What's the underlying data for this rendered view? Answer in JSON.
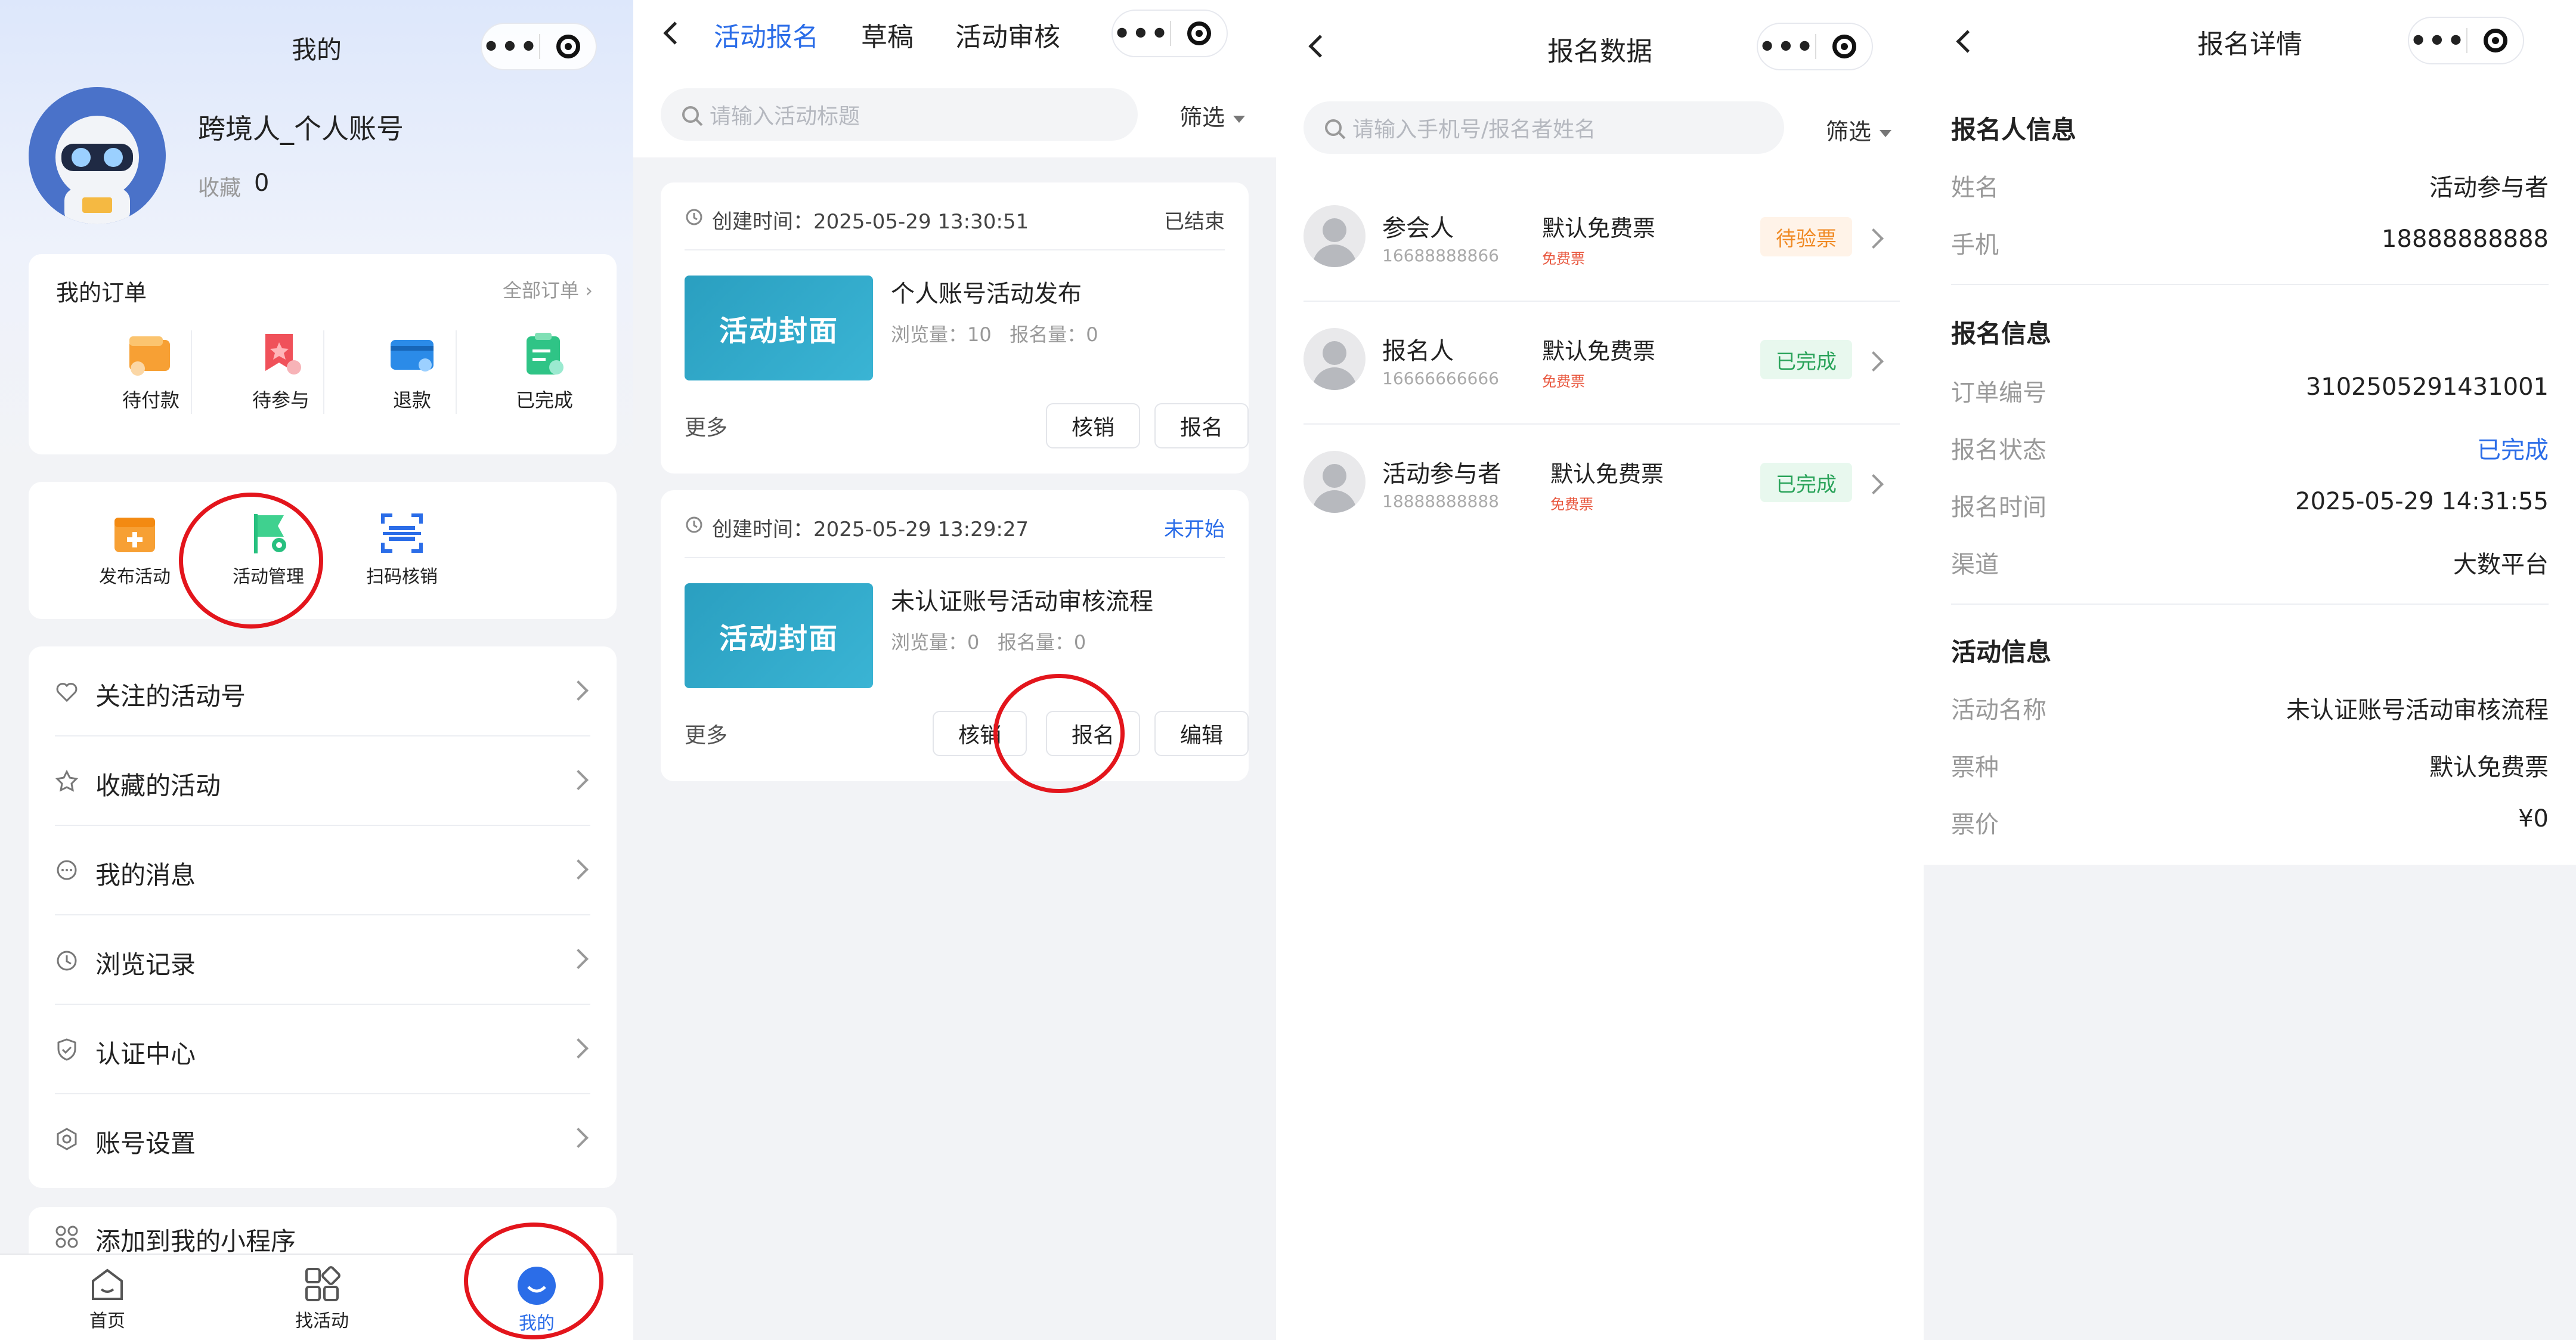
{
  "colors": {
    "accent": "#2b6de8",
    "red_annotation": "#e3151c",
    "done_green": "#2aa35a",
    "pending_orange": "#f08a24"
  },
  "panel1": {
    "title": "我的",
    "user": {
      "name": "跨境人_个人账号",
      "favorites_label": "收藏",
      "favorites_count": "0"
    },
    "orders": {
      "title": "我的订单",
      "all_link": "全部订单",
      "items": [
        {
          "label": "待付款",
          "icon": "wallet-icon"
        },
        {
          "label": "待参与",
          "icon": "ribbon-icon"
        },
        {
          "label": "退款",
          "icon": "card-icon"
        },
        {
          "label": "已完成",
          "icon": "clipboard-icon"
        }
      ]
    },
    "tools": [
      {
        "label": "发布活动",
        "icon": "calendar-plus-icon"
      },
      {
        "label": "活动管理",
        "icon": "flag-gear-icon"
      },
      {
        "label": "扫码核销",
        "icon": "scan-icon"
      }
    ],
    "menu": [
      {
        "label": "关注的活动号",
        "icon": "heart-icon"
      },
      {
        "label": "收藏的活动",
        "icon": "star-icon"
      },
      {
        "label": "我的消息",
        "icon": "chat-icon"
      },
      {
        "label": "浏览记录",
        "icon": "clock-icon"
      },
      {
        "label": "认证中心",
        "icon": "shield-icon"
      },
      {
        "label": "账号设置",
        "icon": "hexagon-gear-icon"
      }
    ],
    "add_miniprogram": "添加到我的小程序",
    "tabbar": [
      {
        "label": "首页",
        "icon": "home-icon"
      },
      {
        "label": "找活动",
        "icon": "grid-icon"
      },
      {
        "label": "我的",
        "icon": "smile-icon",
        "active": true
      }
    ]
  },
  "panel2": {
    "tabs": [
      "活动报名",
      "草稿",
      "活动审核"
    ],
    "active_tab": "活动报名",
    "search_placeholder": "请输入活动标题",
    "filter": "筛选",
    "cards": [
      {
        "created": "创建时间：2025-05-29 13:30:51",
        "status": "已结束",
        "cover": "活动封面",
        "title": "个人账号活动发布",
        "stats": "浏览量：10   报名量：0",
        "more": "更多",
        "buttons": [
          "核销",
          "报名"
        ]
      },
      {
        "created": "创建时间：2025-05-29 13:29:27",
        "status": "未开始",
        "cover": "活动封面",
        "title": "未认证账号活动审核流程",
        "stats": "浏览量：0   报名量：0",
        "more": "更多",
        "buttons": [
          "核销",
          "报名",
          "编辑"
        ]
      }
    ]
  },
  "panel3": {
    "title": "报名数据",
    "search_placeholder": "请输入手机号/报名者姓名",
    "filter": "筛选",
    "rows": [
      {
        "name": "参会人",
        "phone": "16688888866",
        "ticket": "默认免费票",
        "ticket_type": "免费票",
        "status": "待验票"
      },
      {
        "name": "报名人",
        "phone": "16666666666",
        "ticket": "默认免费票",
        "ticket_type": "免费票",
        "status": "已完成"
      },
      {
        "name": "活动参与者",
        "phone": "18888888888",
        "ticket": "默认免费票",
        "ticket_type": "免费票",
        "status": "已完成"
      }
    ]
  },
  "panel4": {
    "title": "报名详情",
    "registrant": {
      "section": "报名人信息",
      "rows": [
        {
          "label": "姓名",
          "value": "活动参与者"
        },
        {
          "label": "手机",
          "value": "18888888888"
        }
      ]
    },
    "registration": {
      "section": "报名信息",
      "rows": [
        {
          "label": "订单编号",
          "value": "3102505291431001"
        },
        {
          "label": "报名状态",
          "value": "已完成"
        },
        {
          "label": "报名时间",
          "value": "2025-05-29 14:31:55"
        },
        {
          "label": "渠道",
          "value": "大数平台"
        }
      ]
    },
    "activity": {
      "section": "活动信息",
      "rows": [
        {
          "label": "活动名称",
          "value": "未认证账号活动审核流程"
        },
        {
          "label": "票种",
          "value": "默认免费票"
        },
        {
          "label": "票价",
          "value": "¥0"
        }
      ]
    }
  }
}
